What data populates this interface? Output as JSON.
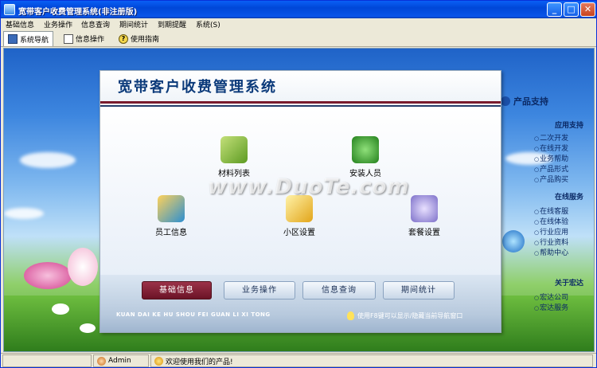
{
  "window": {
    "title": "宽带客户收费管理系统(非注册版)",
    "min": "_",
    "max": "□",
    "close": "✕"
  },
  "menu": [
    "基础信息",
    "业务操作",
    "信息查询",
    "期间统计",
    "到期提醒",
    "系统(S)"
  ],
  "tabs": [
    {
      "label": "系统导航",
      "icon": "monitor-icon",
      "active": true
    },
    {
      "label": "信息操作",
      "icon": "document-icon",
      "active": false
    },
    {
      "label": "使用指南",
      "icon": "help-icon",
      "active": false
    }
  ],
  "panel": {
    "title": "宽带客户收费管理系统",
    "shortcuts": [
      {
        "label": "材料列表",
        "icon": "books-icon",
        "color": "#8bbf3a"
      },
      {
        "label": "安装人员",
        "icon": "installer-icon",
        "color": "#3a9a2c"
      },
      {
        "label": "员工信息",
        "icon": "staff-icon",
        "color": "#e6a11a"
      },
      {
        "label": "小区设置",
        "icon": "folder-icon",
        "color": "#f2c43a"
      },
      {
        "label": "套餐设置",
        "icon": "package-icon",
        "color": "#7c6fc9"
      }
    ],
    "watermark": "www.DuoTe.com",
    "footer_buttons": [
      {
        "label": "基础信息",
        "active": true
      },
      {
        "label": "业务操作",
        "active": false
      },
      {
        "label": "信息查询",
        "active": false
      },
      {
        "label": "期间统计",
        "active": false
      }
    ],
    "pinyin": "KUAN DAI KE HU SHOU FEI GUAN LI XI TONG",
    "hint": "使用F8键可以显示/隐藏当前导航窗口"
  },
  "support": {
    "title": "产品支持",
    "sections": [
      {
        "title": "应用支持",
        "links": [
          "二次开发",
          "在线开发",
          "业务帮助",
          "产品形式",
          "产品购买"
        ]
      },
      {
        "title": "在线服务",
        "links": [
          "在线客服",
          "在线体验",
          "行业应用",
          "行业资料",
          "帮助中心"
        ]
      },
      {
        "title": "关于宏达",
        "links": [
          "宏达公司",
          "宏达服务"
        ]
      }
    ]
  },
  "status": {
    "user": "Admin",
    "message": "欢迎使用我们的产品!"
  }
}
